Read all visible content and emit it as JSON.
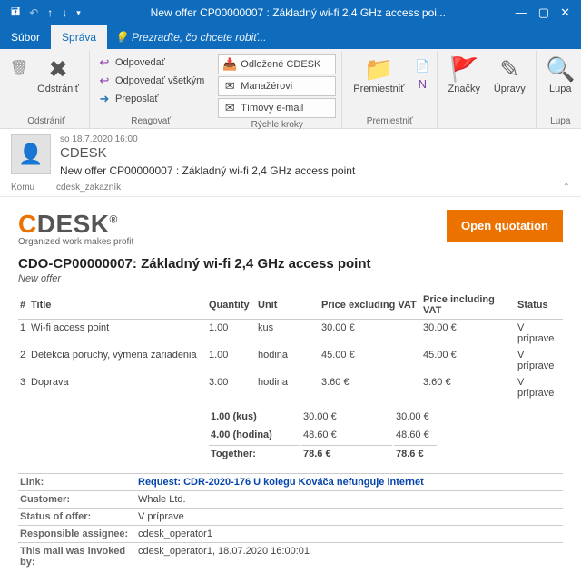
{
  "window": {
    "title": "New offer CP00000007 : Základný wi-fi 2,4 GHz access poi..."
  },
  "menu": {
    "file": "Súbor",
    "message": "Správa",
    "tellme": "Prezraďte, čo chcete robiť..."
  },
  "ribbon": {
    "delete": {
      "label": "Odstrániť",
      "group": "Odstrániť"
    },
    "reply": {
      "reply": "Odpovedať",
      "replyAll": "Odpovedať všetkým",
      "forward": "Preposlať",
      "group": "Reagovať"
    },
    "quick": {
      "a": "Odložené CDESK",
      "b": "Manažérovi",
      "c": "Tímový e-mail",
      "group": "Rýchle kroky"
    },
    "move": {
      "label": "Premiestniť",
      "group": "Premiestniť"
    },
    "tags": {
      "label": "Značky"
    },
    "edit": {
      "label": "Úpravy"
    },
    "zoom": {
      "label": "Lupa",
      "group": "Lupa"
    }
  },
  "header": {
    "date": "so 18.7.2020 16:00",
    "from": "CDESK",
    "subject": "New offer CP00000007 : Základný wi-fi 2,4 GHz access point",
    "toLabel": "Komu",
    "to": "cdesk_zakazník"
  },
  "brand": {
    "tag": "Organized work makes profit",
    "open": "Open quotation"
  },
  "quote": {
    "title": "CDO-CP00000007: Základný wi-fi 2,4 GHz access point",
    "newoffer": "New offer",
    "h": {
      "idx": "#",
      "title": "Title",
      "qty": "Quantity",
      "unit": "Unit",
      "pex": "Price excluding VAT",
      "pinc": "Price including VAT",
      "status": "Status"
    },
    "rows": [
      {
        "i": "1",
        "t": "Wi-fi access point",
        "q": "1.00",
        "u": "kus",
        "pe": "30.00 €",
        "pi": "30.00 €",
        "s": "V príprave"
      },
      {
        "i": "2",
        "t": "Detekcia poruchy, výmena zariadenia",
        "q": "1.00",
        "u": "hodina",
        "pe": "45.00 €",
        "pi": "45.00 €",
        "s": "V príprave"
      },
      {
        "i": "3",
        "t": "Doprava",
        "q": "3.00",
        "u": "hodina",
        "pe": "3.60 €",
        "pi": "3.60 €",
        "s": "V príprave"
      }
    ],
    "s1": {
      "l": "1.00 (kus)",
      "a": "30.00 €",
      "b": "30.00 €"
    },
    "s2": {
      "l": "4.00 (hodina)",
      "a": "48.60 €",
      "b": "48.60 €"
    },
    "tot": {
      "l": "Together:",
      "a": "78.6 €",
      "b": "78.6 €"
    }
  },
  "info": {
    "link": {
      "k": "Link:",
      "v": "Request: CDR-2020-176 U kolegu Kováča nefunguje internet"
    },
    "cust": {
      "k": "Customer:",
      "v": "Whale Ltd."
    },
    "stat": {
      "k": "Status of offer:",
      "v": "V príprave"
    },
    "resp": {
      "k": "Responsible assignee:",
      "v": "cdesk_operator1"
    },
    "inv": {
      "k": "This mail was invoked by:",
      "v": "cdesk_operator1, 18.07.2020 16:00:01"
    }
  }
}
